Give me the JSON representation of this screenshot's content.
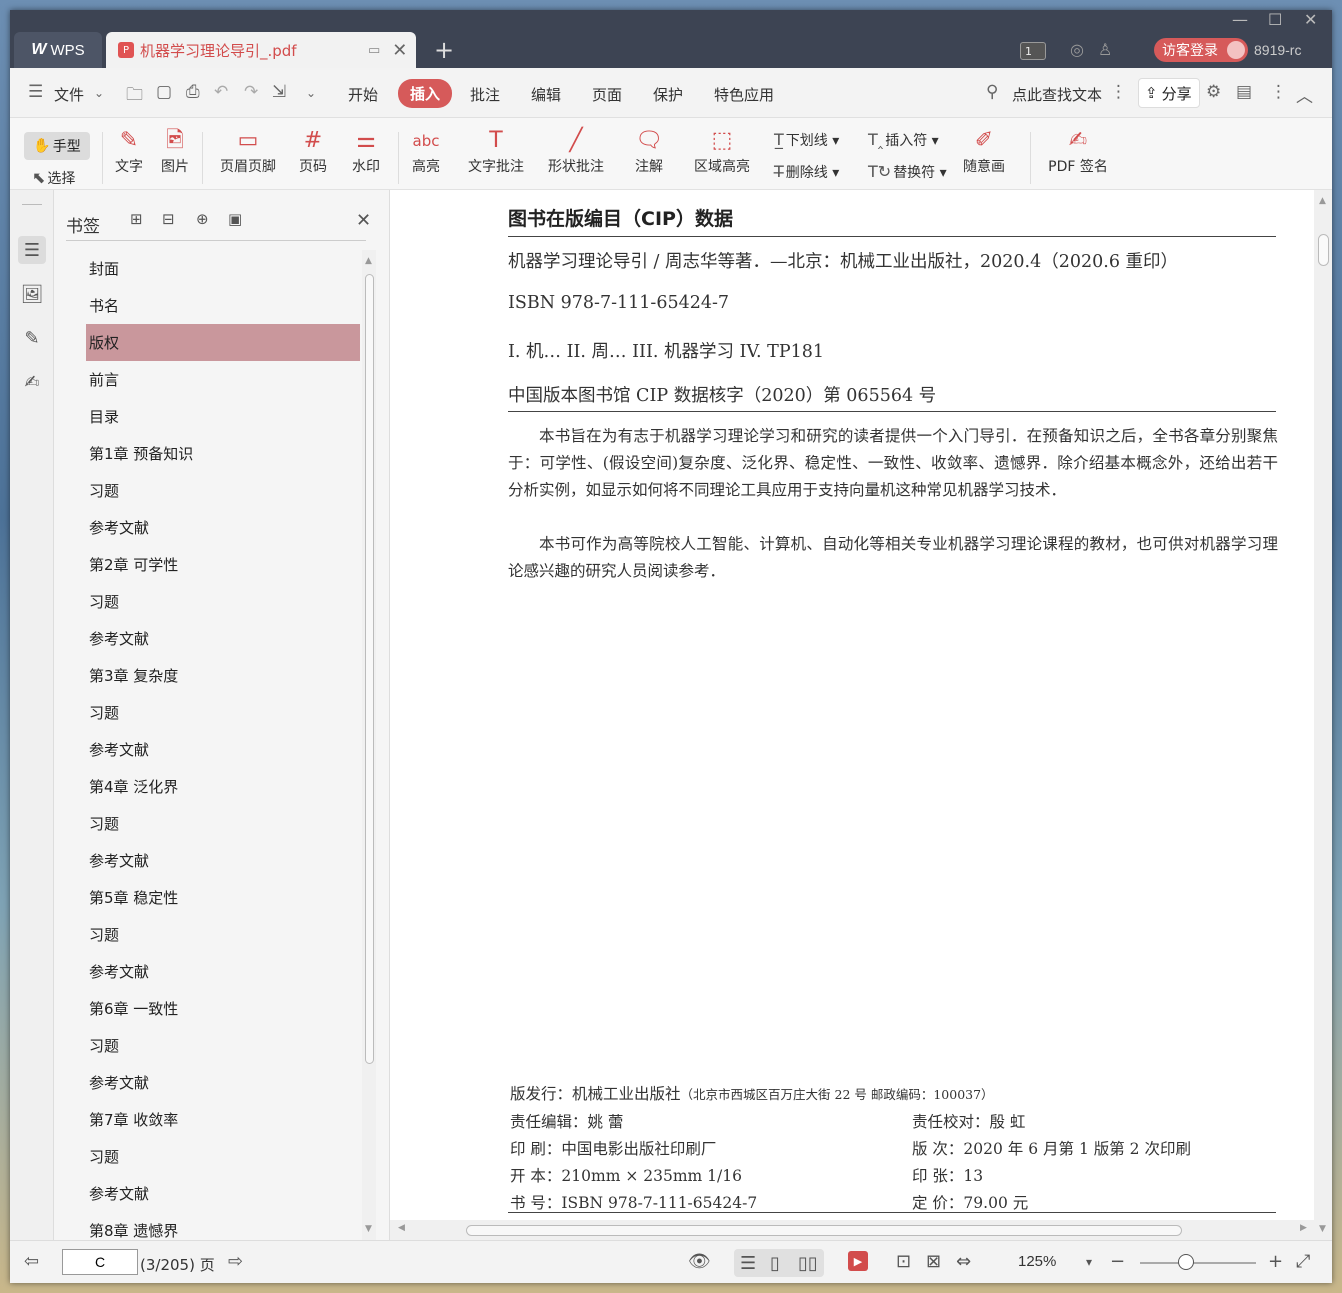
{
  "titlebar": {
    "app_tab": "WPS",
    "app_logo": "W",
    "doc_tab": "机器学习理论导引_.pdf",
    "new_tab": "+",
    "page_badge": "1",
    "login": "访客登录",
    "user_id": "8919-rc"
  },
  "menubar": {
    "file": "文件",
    "tabs": [
      "开始",
      "插入",
      "批注",
      "编辑",
      "页面",
      "保护",
      "特色应用"
    ],
    "active_tab": "插入",
    "search": "点此查找文本",
    "share": "分享"
  },
  "ribbon": {
    "hand": "手型",
    "select": "选择",
    "text": "文字",
    "image": "图片",
    "header_footer": "页眉页脚",
    "page_number": "页码",
    "watermark": "水印",
    "highlight": "高亮",
    "text_annot": "文字批注",
    "shape_annot": "形状批注",
    "note": "注解",
    "area_highlight": "区域高亮",
    "underline": "下划线",
    "strikethrough": "删除线",
    "insert_mark": "插入符",
    "replace_mark": "替换符",
    "freehand": "随意画",
    "pdf_sign": "PDF 签名"
  },
  "panel": {
    "title": "书签",
    "bookmarks": [
      {
        "label": "封面",
        "expandable": false
      },
      {
        "label": "书名",
        "expandable": false
      },
      {
        "label": "版权",
        "expandable": false,
        "selected": true
      },
      {
        "label": "前言",
        "expandable": false
      },
      {
        "label": "目录",
        "expandable": false
      },
      {
        "label": "第1章 预备知识",
        "expandable": true
      },
      {
        "label": "习题",
        "expandable": false
      },
      {
        "label": "参考文献",
        "expandable": false
      },
      {
        "label": "第2章 可学性",
        "expandable": true
      },
      {
        "label": "习题",
        "expandable": false
      },
      {
        "label": "参考文献",
        "expandable": false
      },
      {
        "label": "第3章 复杂度",
        "expandable": true
      },
      {
        "label": "习题",
        "expandable": false
      },
      {
        "label": "参考文献",
        "expandable": false
      },
      {
        "label": "第4章 泛化界",
        "expandable": true
      },
      {
        "label": "习题",
        "expandable": false
      },
      {
        "label": "参考文献",
        "expandable": false
      },
      {
        "label": "第5章 稳定性",
        "expandable": true
      },
      {
        "label": "习题",
        "expandable": false
      },
      {
        "label": "参考文献",
        "expandable": false
      },
      {
        "label": "第6章 一致性",
        "expandable": true
      },
      {
        "label": "习题",
        "expandable": false
      },
      {
        "label": "参考文献",
        "expandable": false
      },
      {
        "label": "第7章 收敛率",
        "expandable": true
      },
      {
        "label": "习题",
        "expandable": false
      },
      {
        "label": "参考文献",
        "expandable": false
      },
      {
        "label": "第8章 遗憾界",
        "expandable": true
      }
    ]
  },
  "page": {
    "cip_title": "图书在版编目（CIP）数据",
    "line1": "机器学习理论导引 / 周志华等著．—北京：机械工业出版社，2020.4（2020.6 重印）",
    "line2": "ISBN 978-7-111-65424-7",
    "line3": "I. 机…   II. 周…   III. 机器学习   IV. TP181",
    "line4": "中国版本图书馆 CIP 数据核字（2020）第 065564 号",
    "para1": "本书旨在为有志于机器学习理论学习和研究的读者提供一个入门导引．在预备知识之后，全书各章分别聚焦于：可学性、(假设空间)复杂度、泛化界、稳定性、一致性、收敛率、遗憾界．除介绍基本概念外，还给出若干分析实例，如显示如何将不同理论工具应用于支持向量机这种常见机器学习技术．",
    "para2": "本书可作为高等院校人工智能、计算机、自动化等相关专业机器学习理论课程的教材，也可供对机器学习理论感兴趣的研究人员阅读参考．",
    "publisher_label": "版发行：机械工业出版社",
    "publisher_addr": "（北京市西城区百万庄大街 22 号   邮政编码：100037）",
    "editor": "责任编辑：姚   蕾",
    "proofreader": "责任校对：殷   虹",
    "printer": "印      刷：中国电影出版社印刷厂",
    "edition": "版      次：2020 年 6 月第 1 版第 2 次印刷",
    "format": "开      本：210mm × 235mm   1/16",
    "sheets": "印      张：13",
    "isbn": "书      号：ISBN 978-7-111-65424-7",
    "price": "定      价：79.00 元"
  },
  "statusbar": {
    "page_input": "C",
    "page_total": "(3/205) 页",
    "zoom": "125%",
    "zoom_level_percent": 40
  }
}
